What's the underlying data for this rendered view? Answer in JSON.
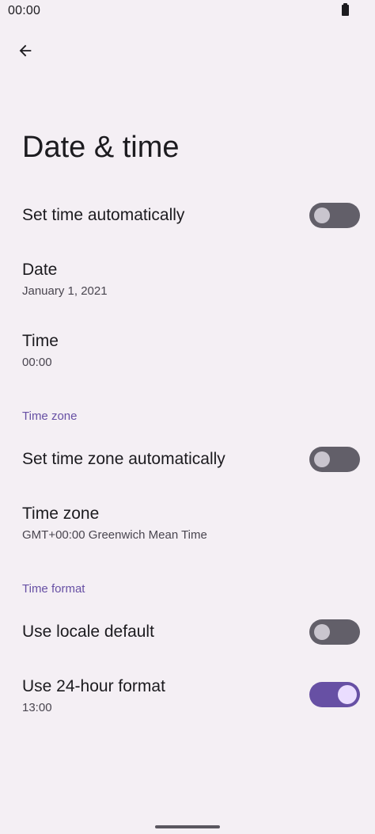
{
  "status_bar": {
    "time": "00:00",
    "battery_icon": "battery-icon"
  },
  "header": {
    "back_icon": "arrow-back-icon",
    "title": "Date & time"
  },
  "settings": {
    "set_time_auto": {
      "title": "Set time automatically",
      "enabled": false
    },
    "date": {
      "title": "Date",
      "value": "January 1, 2021"
    },
    "time": {
      "title": "Time",
      "value": "00:00"
    },
    "time_zone_section": "Time zone",
    "set_tz_auto": {
      "title": "Set time zone automatically",
      "enabled": false
    },
    "time_zone": {
      "title": "Time zone",
      "value": "GMT+00:00 Greenwich Mean Time"
    },
    "time_format_section": "Time format",
    "locale_default": {
      "title": "Use locale default",
      "enabled": false
    },
    "hour_24": {
      "title": "Use 24-hour format",
      "value": "13:00",
      "enabled": true
    }
  },
  "colors": {
    "background": "#f4eff4",
    "accent": "#6750a4",
    "switch_off_track": "#625f69",
    "switch_on_thumb": "#eaddff"
  }
}
